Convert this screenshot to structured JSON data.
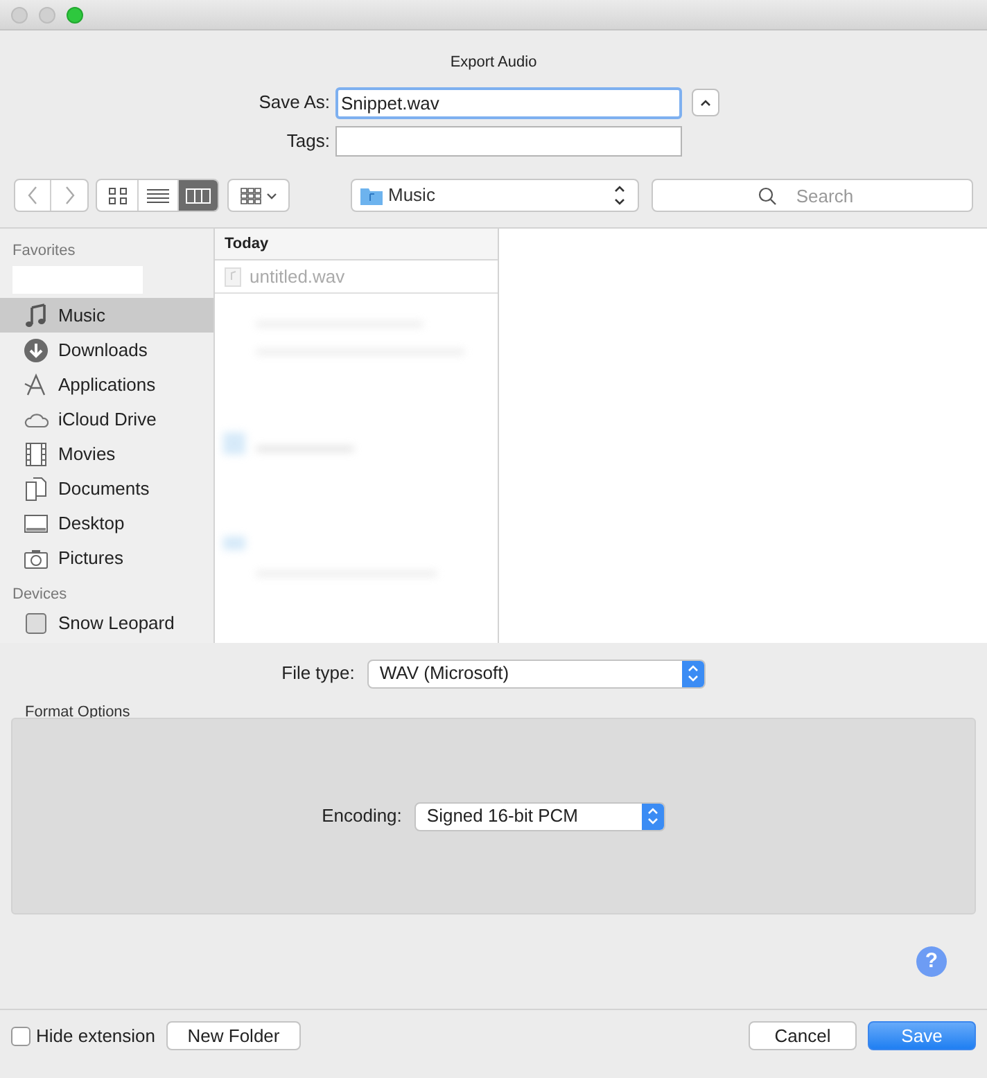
{
  "window": {
    "title": "Export Audio"
  },
  "save_as": {
    "label": "Save As:",
    "value": "Snippet.wav"
  },
  "tags": {
    "label": "Tags:"
  },
  "toolbar": {
    "view_modes": [
      {
        "kind": "icons",
        "selected": false
      },
      {
        "kind": "list",
        "selected": false
      },
      {
        "kind": "columns",
        "selected": true
      }
    ],
    "location": "Music",
    "search": {
      "placeholder": "Search"
    }
  },
  "sidebar": {
    "sections": [
      {
        "title": "Favorites",
        "items": [
          {
            "kind": "hidden"
          },
          {
            "kind": "music",
            "label": "Music",
            "selected": true
          },
          {
            "kind": "downloads",
            "label": "Downloads",
            "selected": false
          },
          {
            "kind": "applications",
            "label": "Applications",
            "selected": false
          },
          {
            "kind": "cloud",
            "label": "iCloud Drive",
            "selected": false
          },
          {
            "kind": "movies",
            "label": "Movies",
            "selected": false
          },
          {
            "kind": "documents",
            "label": "Documents",
            "selected": false
          },
          {
            "kind": "desktop",
            "label": "Desktop",
            "selected": false
          },
          {
            "kind": "pictures",
            "label": "Pictures",
            "selected": false
          }
        ]
      },
      {
        "title": "Devices",
        "items": [
          {
            "kind": "disk",
            "label": "Snow Leopard",
            "selected": false
          }
        ]
      }
    ]
  },
  "column": {
    "header": "Today",
    "files": [
      {
        "name": "untitled.wav",
        "disabled": true
      }
    ]
  },
  "file_type": {
    "label": "File type:",
    "value": "WAV (Microsoft)"
  },
  "format_options": {
    "title": "Format Options",
    "encoding": {
      "label": "Encoding:",
      "value": "Signed 16-bit PCM"
    }
  },
  "help": {
    "label": "?"
  },
  "hide_extension": {
    "label": "Hide extension",
    "checked": false
  },
  "buttons": [
    {
      "label": "New Folder",
      "kind": "secondary"
    },
    {
      "label": "Cancel",
      "kind": "secondary"
    },
    {
      "label": "Save",
      "kind": "primary"
    }
  ]
}
